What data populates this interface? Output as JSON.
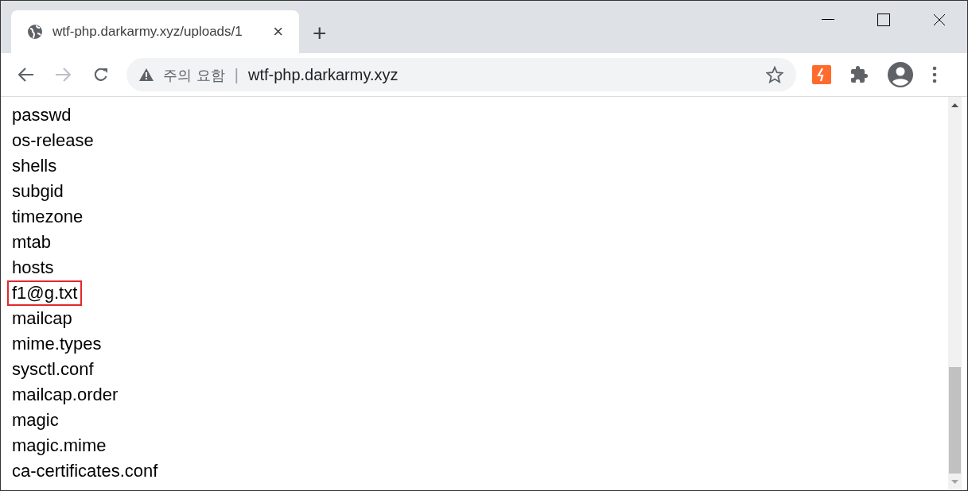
{
  "tab": {
    "title": "wtf-php.darkarmy.xyz/uploads/1",
    "close": "×",
    "selected": true
  },
  "new_tab": "+",
  "address_bar": {
    "security_label": "주의 요함",
    "separator": "|",
    "url": "wtf-php.darkarmy.xyz"
  },
  "page": {
    "lines": [
      {
        "text": "passwd",
        "highlighted": false
      },
      {
        "text": "os-release",
        "highlighted": false
      },
      {
        "text": "shells",
        "highlighted": false
      },
      {
        "text": "subgid",
        "highlighted": false
      },
      {
        "text": "timezone",
        "highlighted": false
      },
      {
        "text": "mtab",
        "highlighted": false
      },
      {
        "text": "hosts",
        "highlighted": false
      },
      {
        "text": "f1@g.txt",
        "highlighted": true
      },
      {
        "text": "mailcap",
        "highlighted": false
      },
      {
        "text": "mime.types",
        "highlighted": false
      },
      {
        "text": "sysctl.conf",
        "highlighted": false
      },
      {
        "text": "mailcap.order",
        "highlighted": false
      },
      {
        "text": "magic",
        "highlighted": false
      },
      {
        "text": "magic.mime",
        "highlighted": false
      },
      {
        "text": "ca-certificates.conf",
        "highlighted": false
      }
    ]
  }
}
